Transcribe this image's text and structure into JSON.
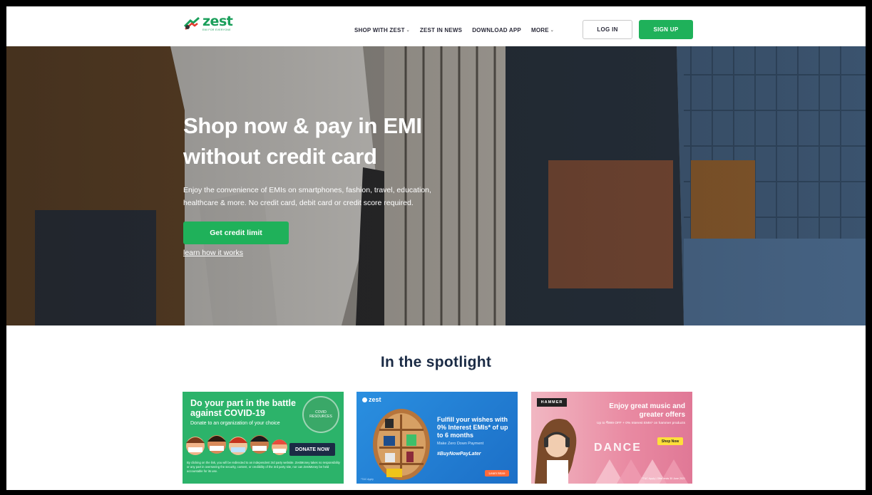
{
  "header": {
    "logo_word": "zest",
    "logo_tagline": "EMI FOR EVERYONE",
    "nav": [
      {
        "label": "SHOP WITH ZEST",
        "caret": "⌄"
      },
      {
        "label": "ZEST IN NEWS",
        "caret": ""
      },
      {
        "label": "DOWNLOAD APP",
        "caret": ""
      },
      {
        "label": "MORE",
        "caret": "⌄"
      }
    ],
    "login_label": "LOG IN",
    "signup_label": "SIGN UP"
  },
  "hero": {
    "title_line1": "Shop now & pay in EMI",
    "title_line2": "without credit card",
    "description": "Enjoy the convenience of EMIs on smartphones, fashion, travel, education, healthcare & more. No credit card, debit card or credit score required.",
    "cta_label": "Get credit limit",
    "link_label": "learn how it works"
  },
  "spotlight": {
    "title": "In the spotlight",
    "cards": [
      {
        "headline": "Do your part in the battle against COVID-19",
        "subtext": "Donate to an organization of your choice",
        "badge": "COVID RESOURCES",
        "button": "DONATE NOW",
        "disclaimer": "By clicking on the link, you will be redirected to an independent 3rd party website. ZestMoney takes no responsibility or any part in overseeing the security, content, or credibility of the 3rd party site, nor can ZestMoney be held accountable for its use."
      },
      {
        "logo": "zest",
        "headline": "Fulfill your wishes with 0% Interest EMIs* of up to 6 months",
        "subtext": "Make Zero Down Payment",
        "tag": "#BuyNowPayLater",
        "button": "Learn More",
        "note": "*T&C Apply"
      },
      {
        "brand": "HAMMER",
        "headline": "Enjoy great music and greater offers",
        "subtext": "Up to ₹999 OFF + 0% Interest EMIs* on hammer products",
        "button": "Shop Now",
        "overlay_word": "DANCE",
        "note": "*T&C Apply | Offer ends 30 June 2021"
      }
    ]
  },
  "colors": {
    "brand_green": "#1fb15a",
    "navy": "#1b2b45"
  }
}
